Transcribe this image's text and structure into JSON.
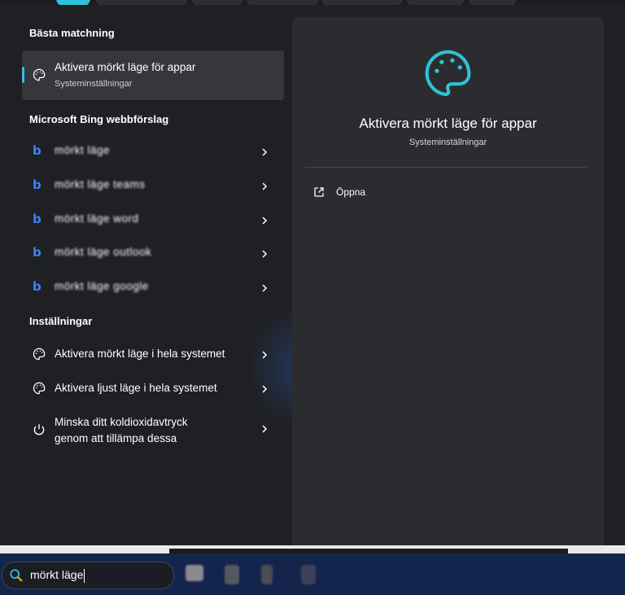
{
  "best_match": {
    "heading": "Bästa matchning",
    "title": "Aktivera mörkt läge för appar",
    "subtitle": "Systeminställningar",
    "icon": "palette-icon"
  },
  "bing": {
    "heading": "Microsoft Bing webbförslag",
    "items": [
      {
        "label": "mörkt läge"
      },
      {
        "label": "mörkt läge teams"
      },
      {
        "label": "mörkt läge word"
      },
      {
        "label": "mörkt läge outlook"
      },
      {
        "label": "mörkt läge google"
      }
    ],
    "icon": "bing-icon"
  },
  "settings": {
    "heading": "Inställningar",
    "items": [
      {
        "label": "Aktivera mörkt läge i hela systemet",
        "icon": "palette-icon"
      },
      {
        "label": "Aktivera ljust läge i hela systemet",
        "icon": "palette-icon"
      },
      {
        "label_line1": "Minska ditt koldioxidavtryck",
        "label_line2": "genom att tillämpa dessa",
        "icon": "power-icon"
      }
    ]
  },
  "preview": {
    "title": "Aktivera mörkt läge för appar",
    "subtitle": "Systeminställningar",
    "open_label": "Öppna",
    "open_icon": "open-external-icon"
  },
  "search": {
    "value": "mörkt läge",
    "icon": "search-icon"
  },
  "colors": {
    "accent": "#2fc2d6",
    "panel": "#1f2024",
    "preview_panel": "#2b2c30",
    "taskbar": "#14254d"
  }
}
